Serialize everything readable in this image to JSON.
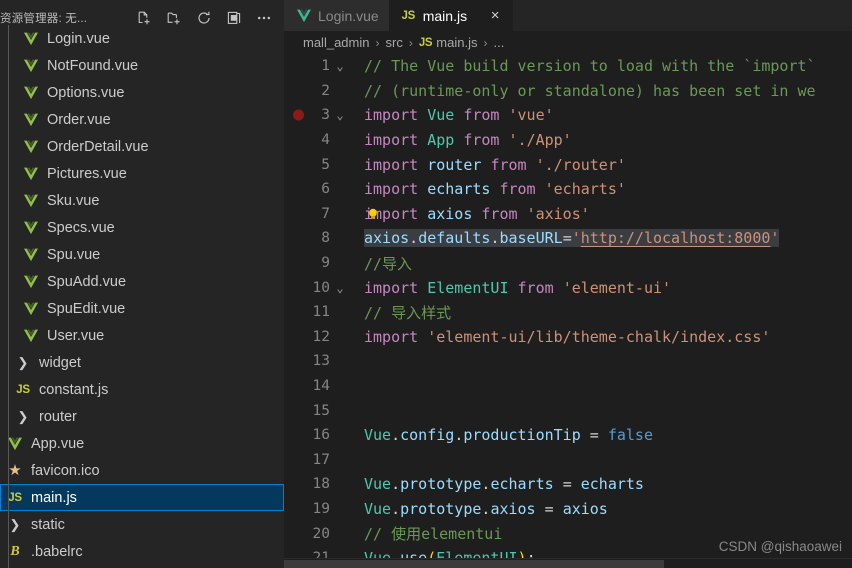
{
  "sidebar": {
    "title": "资源管理器: 无...",
    "actions": [
      {
        "name": "new-file-icon",
        "label": "新建文件"
      },
      {
        "name": "new-folder-icon",
        "label": "新建文件夹"
      },
      {
        "name": "refresh-icon",
        "label": "刷新资源管理器"
      },
      {
        "name": "collapse-all-icon",
        "label": "全部折叠"
      },
      {
        "name": "more-actions-icon",
        "label": "查看和更多操作..."
      }
    ],
    "items": [
      {
        "label": "Login.vue",
        "icon": "vue-file-icon",
        "indent": 2,
        "selected": false,
        "kind": "file"
      },
      {
        "label": "NotFound.vue",
        "icon": "vue-file-icon",
        "indent": 2,
        "selected": false,
        "kind": "file"
      },
      {
        "label": "Options.vue",
        "icon": "vue-file-icon",
        "indent": 2,
        "selected": false,
        "kind": "file"
      },
      {
        "label": "Order.vue",
        "icon": "vue-file-icon",
        "indent": 2,
        "selected": false,
        "kind": "file"
      },
      {
        "label": "OrderDetail.vue",
        "icon": "vue-file-icon",
        "indent": 2,
        "selected": false,
        "kind": "file"
      },
      {
        "label": "Pictures.vue",
        "icon": "vue-file-icon",
        "indent": 2,
        "selected": false,
        "kind": "file"
      },
      {
        "label": "Sku.vue",
        "icon": "vue-file-icon",
        "indent": 2,
        "selected": false,
        "kind": "file"
      },
      {
        "label": "Specs.vue",
        "icon": "vue-file-icon",
        "indent": 2,
        "selected": false,
        "kind": "file"
      },
      {
        "label": "Spu.vue",
        "icon": "vue-file-icon",
        "indent": 2,
        "selected": false,
        "kind": "file"
      },
      {
        "label": "SpuAdd.vue",
        "icon": "vue-file-icon",
        "indent": 2,
        "selected": false,
        "kind": "file"
      },
      {
        "label": "SpuEdit.vue",
        "icon": "vue-file-icon",
        "indent": 2,
        "selected": false,
        "kind": "file"
      },
      {
        "label": "User.vue",
        "icon": "vue-file-icon",
        "indent": 2,
        "selected": false,
        "kind": "file"
      },
      {
        "label": "widget",
        "icon": "chevron-right-icon",
        "indent": 1,
        "selected": false,
        "kind": "folder"
      },
      {
        "label": "constant.js",
        "icon": "js-file-icon",
        "indent": 1,
        "selected": false,
        "kind": "file"
      },
      {
        "label": "router",
        "icon": "chevron-right-icon",
        "indent": 1,
        "selected": false,
        "kind": "folder"
      },
      {
        "label": "App.vue",
        "icon": "vue-file-icon",
        "indent": 0,
        "selected": false,
        "kind": "file"
      },
      {
        "label": "favicon.ico",
        "icon": "star-file-icon",
        "indent": 0,
        "selected": false,
        "kind": "file"
      },
      {
        "label": "main.js",
        "icon": "js-file-icon",
        "indent": 0,
        "selected": true,
        "kind": "file"
      },
      {
        "label": "static",
        "icon": "chevron-right-icon",
        "indent": 0,
        "selected": false,
        "kind": "folder"
      },
      {
        "label": ".babelrc",
        "icon": "babel-file-icon",
        "indent": 0,
        "selected": false,
        "kind": "file"
      }
    ]
  },
  "tabs": [
    {
      "label": "Login.vue",
      "icon": "vue-file-icon",
      "active": false,
      "closable": false
    },
    {
      "label": "main.js",
      "icon": "js-file-icon",
      "active": true,
      "closable": true,
      "close_label": "×"
    }
  ],
  "breadcrumb": {
    "parts": [
      "mall_admin",
      "src",
      "main.js",
      "..."
    ],
    "separator": "›",
    "file_icon": "js-file-icon"
  },
  "editor": {
    "language": "javascript",
    "selected_line": 8,
    "breakpoint_line": 3,
    "lightbulb_line": 7,
    "folded_markers": [
      1,
      3,
      10
    ],
    "lines": [
      {
        "n": 1,
        "fold": "⌄",
        "text": "// The Vue build version to load with the `import`"
      },
      {
        "n": 2,
        "fold": "",
        "text": "// (runtime-only or standalone) has been set in we"
      },
      {
        "n": 3,
        "fold": "⌄",
        "text": "import Vue from 'vue'"
      },
      {
        "n": 4,
        "fold": "",
        "text": "import App from './App'"
      },
      {
        "n": 5,
        "fold": "",
        "text": "import router from './router'"
      },
      {
        "n": 6,
        "fold": "",
        "text": "import echarts from 'echarts'"
      },
      {
        "n": 7,
        "fold": "",
        "text": "import axios from 'axios'"
      },
      {
        "n": 8,
        "fold": "",
        "text": "axios.defaults.baseURL='http://localhost:8000'"
      },
      {
        "n": 9,
        "fold": "",
        "text": "//导入"
      },
      {
        "n": 10,
        "fold": "⌄",
        "text": "import ElementUI from 'element-ui'"
      },
      {
        "n": 11,
        "fold": "",
        "text": "// 导入样式"
      },
      {
        "n": 12,
        "fold": "",
        "text": "import 'element-ui/lib/theme-chalk/index.css'"
      },
      {
        "n": 13,
        "fold": "",
        "text": ""
      },
      {
        "n": 14,
        "fold": "",
        "text": ""
      },
      {
        "n": 15,
        "fold": "",
        "text": ""
      },
      {
        "n": 16,
        "fold": "",
        "text": "Vue.config.productionTip = false"
      },
      {
        "n": 17,
        "fold": "",
        "text": ""
      },
      {
        "n": 18,
        "fold": "",
        "text": "Vue.prototype.echarts = echarts"
      },
      {
        "n": 19,
        "fold": "",
        "text": "Vue.prototype.axios = axios"
      },
      {
        "n": 20,
        "fold": "",
        "text": "// 使用elementui"
      },
      {
        "n": 21,
        "fold": "",
        "text": "Vue.use(ElementUI);"
      }
    ],
    "url_value": "http://localhost:8000"
  },
  "watermark": "CSDN @qishaoawei",
  "colors": {
    "sidebar_bg": "#252526",
    "editor_bg": "#1e1e1e",
    "tab_inactive_bg": "#2d2d2d",
    "selection_bg": "#04395e",
    "selection_border": "#007fd4",
    "comment": "#6a9955",
    "keyword": "#c586c0",
    "string": "#ce9178",
    "variable": "#9cdcfe",
    "class": "#4ec9b0",
    "breakpoint": "#8b1a1a",
    "lightbulb": "#ffcc00"
  }
}
